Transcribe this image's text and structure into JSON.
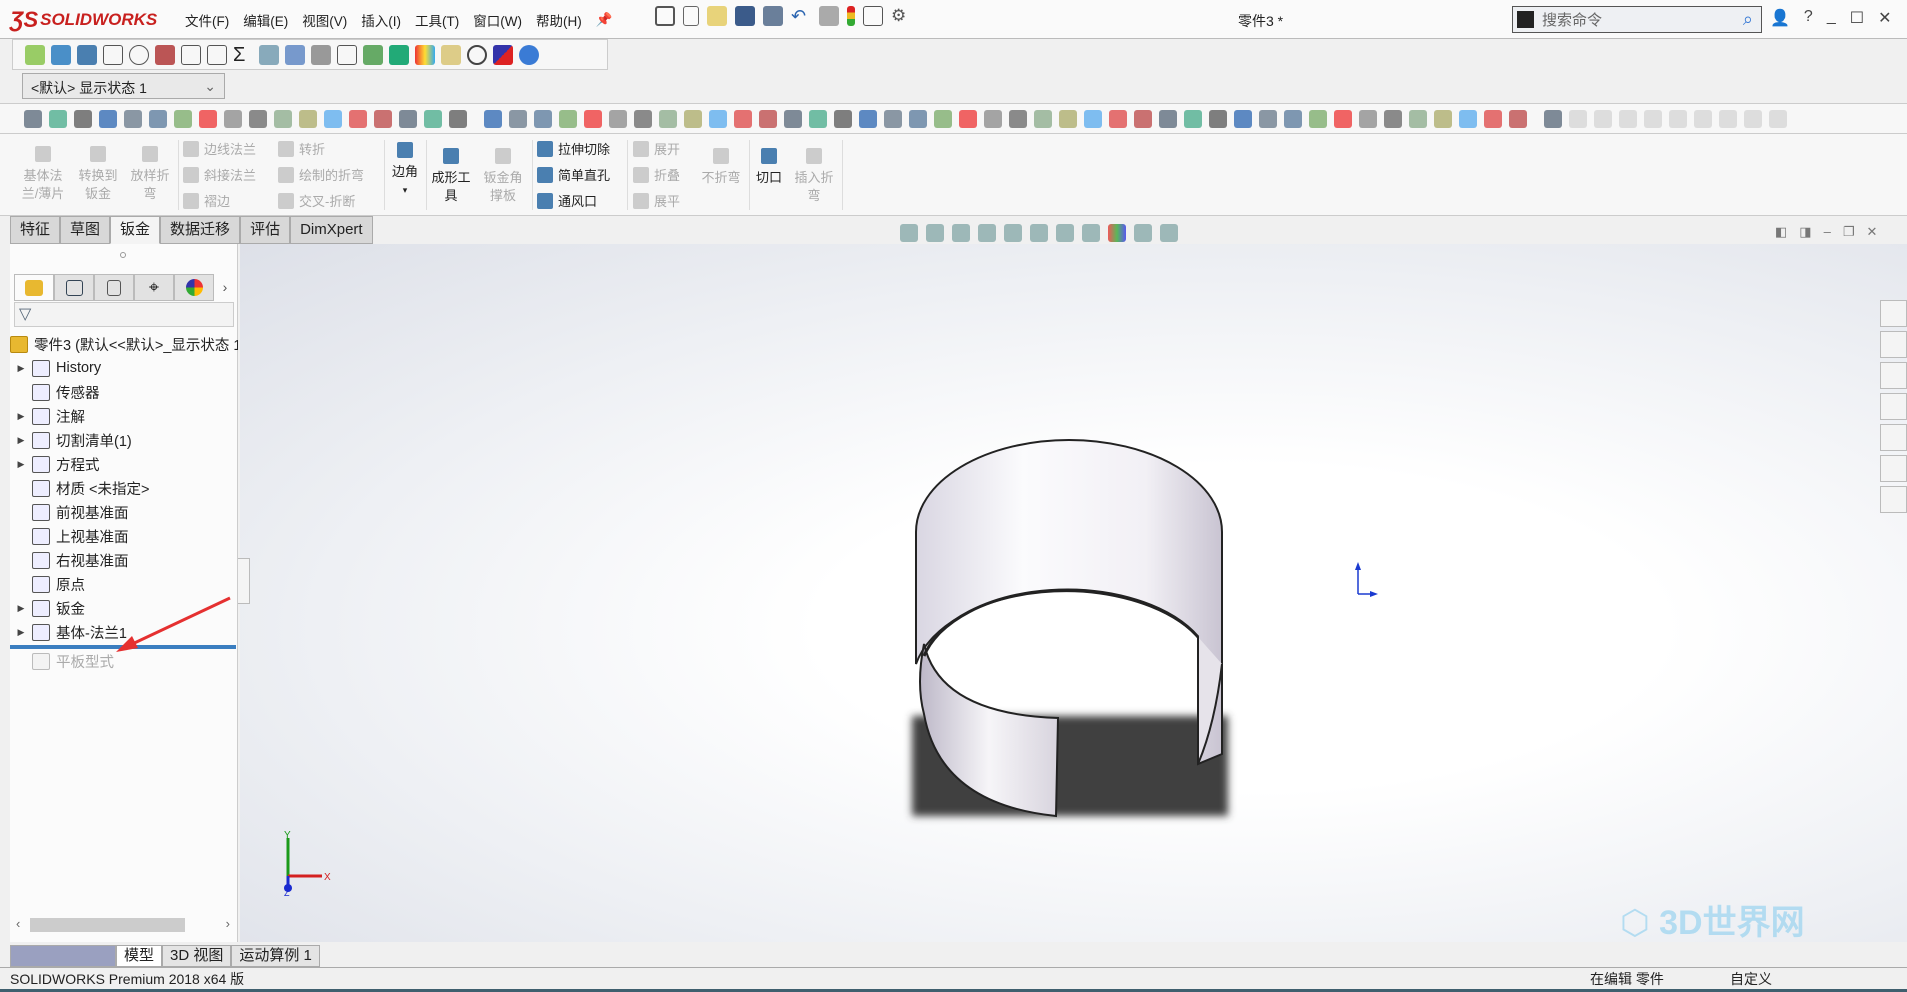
{
  "app": {
    "logo": "SOLIDWORKS",
    "document_title": "零件3 *"
  },
  "menu": [
    "文件(F)",
    "编辑(E)",
    "视图(V)",
    "插入(I)",
    "工具(T)",
    "窗口(W)",
    "帮助(H)"
  ],
  "search": {
    "placeholder": "搜索命令"
  },
  "window_controls": {
    "help": "?",
    "minimize": "_",
    "maximize": "☐",
    "close": "✕"
  },
  "display_state": {
    "value": "<默认> 显示状态 1"
  },
  "ribbon": {
    "base_flange": "基体法\n兰/薄片",
    "convert": "转换到\n钣金",
    "lofted_bend": "放样折\n弯",
    "edge_flange": "边线法兰",
    "miter_flange": "斜接法兰",
    "hem": "褶边",
    "jog": "转折",
    "sketched_bend": "绘制的折弯",
    "cross_break": "交叉-折断",
    "corners": "边角",
    "forming_tool": "成形工\n具",
    "gusset": "钣金角\n撑板",
    "extruded_cut": "拉伸切除",
    "simple_hole": "简单直孔",
    "vent": "通风口",
    "unfold": "展开",
    "fold": "折叠",
    "flatten": "展平",
    "no_bends": "不折弯",
    "rip": "切口",
    "insert_bends": "插入折\n弯"
  },
  "command_tabs": [
    {
      "label": "特征",
      "active": false
    },
    {
      "label": "草图",
      "active": false
    },
    {
      "label": "钣金",
      "active": true
    },
    {
      "label": "数据迁移",
      "active": false
    },
    {
      "label": "评估",
      "active": false
    },
    {
      "label": "DimXpert",
      "active": false
    }
  ],
  "tree": {
    "root": "零件3  (默认<<默认>_显示状态 1>)",
    "items": [
      {
        "label": "History",
        "expandable": true,
        "icon": "history-folder-icon"
      },
      {
        "label": "传感器",
        "expandable": false,
        "icon": "sensor-folder-icon"
      },
      {
        "label": "注解",
        "expandable": true,
        "icon": "annotation-folder-icon"
      },
      {
        "label": "切割清单(1)",
        "expandable": true,
        "icon": "cut-list-icon"
      },
      {
        "label": "方程式",
        "expandable": true,
        "icon": "equation-folder-icon"
      },
      {
        "label": "材质 <未指定>",
        "expandable": false,
        "icon": "material-icon"
      },
      {
        "label": "前视基准面",
        "expandable": false,
        "icon": "plane-icon"
      },
      {
        "label": "上视基准面",
        "expandable": false,
        "icon": "plane-icon"
      },
      {
        "label": "右视基准面",
        "expandable": false,
        "icon": "plane-icon"
      },
      {
        "label": "原点",
        "expandable": false,
        "icon": "origin-icon"
      },
      {
        "label": "钣金",
        "expandable": true,
        "icon": "sheet-metal-icon"
      },
      {
        "label": "基体-法兰1",
        "expandable": true,
        "icon": "base-flange-icon"
      }
    ],
    "suppressed_item": "平板型式"
  },
  "bottom_tabs": [
    {
      "label": "模型",
      "active": true
    },
    {
      "label": "3D 视图",
      "active": false
    },
    {
      "label": "运动算例 1",
      "active": false
    }
  ],
  "status": {
    "version": "SOLIDWORKS Premium 2018 x64 版",
    "mode": "在编辑 零件",
    "units": "自定义"
  },
  "triad": {
    "x": "X",
    "y": "Y",
    "z": "Z"
  },
  "watermark": "3D世界网",
  "colors": {
    "brand_red": "#c8201e",
    "rollback_bar": "#3b7ec0",
    "annotation_arrow": "#e53030"
  }
}
